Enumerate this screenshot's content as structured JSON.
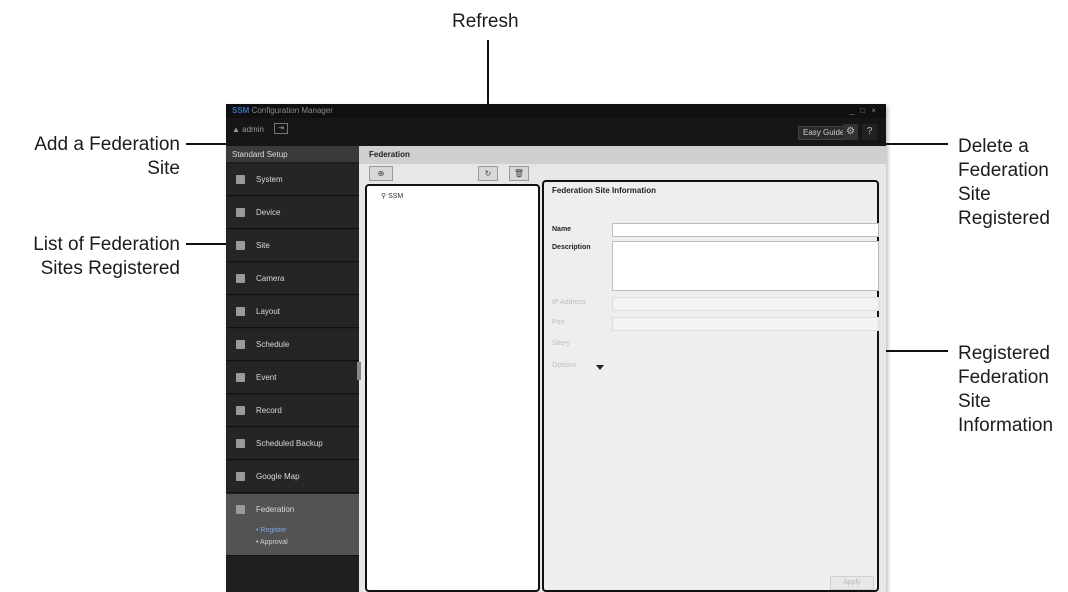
{
  "callouts": {
    "refresh": "Refresh",
    "add_site": [
      "Add a Federation",
      "Site"
    ],
    "list_sites": [
      "List of Federation",
      "Sites Registered"
    ],
    "delete_site": [
      "Delete a",
      "Federation",
      "Site",
      "Registered"
    ],
    "registered_info": [
      "Registered",
      "Federation",
      "Site",
      "Information"
    ]
  },
  "window": {
    "title_brand": "SSM",
    "title_rest": " Configuration Manager",
    "controls": "_ □ ×",
    "user": "admin",
    "easy_guide": "Easy Guide",
    "help": "?"
  },
  "sidebar": {
    "header": "Standard Setup",
    "items": [
      {
        "label": "System",
        "icon": "system-icon"
      },
      {
        "label": "Device",
        "icon": "device-icon"
      },
      {
        "label": "Site",
        "icon": "site-icon"
      },
      {
        "label": "Camera",
        "icon": "camera-icon"
      },
      {
        "label": "Layout",
        "icon": "layout-icon"
      },
      {
        "label": "Schedule",
        "icon": "schedule-icon"
      },
      {
        "label": "Event",
        "icon": "event-icon"
      },
      {
        "label": "Record",
        "icon": "record-icon"
      },
      {
        "label": "Scheduled Backup",
        "icon": "backup-icon"
      },
      {
        "label": "Google Map",
        "icon": "map-icon"
      },
      {
        "label": "Federation",
        "icon": "federation-icon"
      }
    ],
    "sub_items": [
      "Register",
      "Approval"
    ]
  },
  "main": {
    "title": "Federation",
    "tree_root": "SSM",
    "info_title": "Federation Site Information",
    "fields": {
      "name": "Name",
      "description": "Description",
      "ip": "IP Address",
      "port": "Port",
      "id": "Sitery",
      "options": "Options"
    },
    "apply": "Apply"
  }
}
